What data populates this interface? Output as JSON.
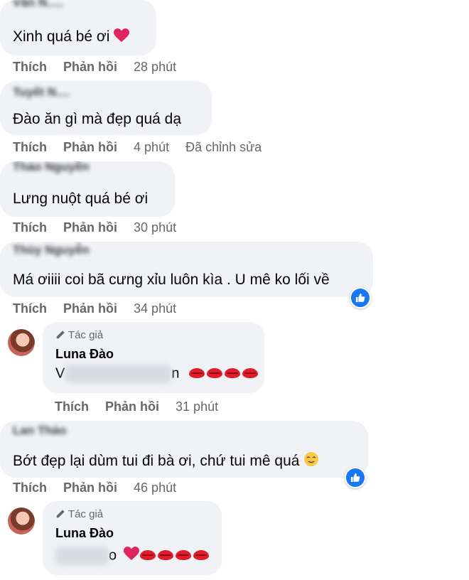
{
  "comments": [
    {
      "text": "Xinh quá bé ơi",
      "like": "Thích",
      "reply": "Phản hồi",
      "time": "28 phút",
      "edited": ""
    },
    {
      "text": "Đào ăn gì mà đẹp quá dạ",
      "like": "Thích",
      "reply": "Phản hồi",
      "time": "4 phút",
      "edited": "Đã chỉnh sửa"
    },
    {
      "text": "Lưng nuột quá bé ơi",
      "like": "Thích",
      "reply": "Phản hồi",
      "time": "30 phút",
      "edited": ""
    },
    {
      "text": "Má ơiiii coi bã cưng xỉu luôn kìa . U mê ko lối về",
      "like": "Thích",
      "reply": "Phản hồi",
      "time": "34 phút",
      "edited": ""
    },
    {
      "text": "Bớt đẹp lại dùm tui đi bà ơi, chứ tui mê quá",
      "like": "Thích",
      "reply": "Phản hồi",
      "time": "46 phút",
      "edited": ""
    }
  ],
  "replies": [
    {
      "author_tag": "Tác giả",
      "author": "Luna Đào",
      "text_prefix": "V",
      "text_suffix": "n",
      "like": "Thích",
      "reply": "Phản hồi",
      "time": "31 phút"
    },
    {
      "author_tag": "Tác giả",
      "author": "Luna Đào",
      "text_prefix": "",
      "text_suffix": "o",
      "like": "Thích",
      "reply": "Phản hồi",
      "time": ""
    }
  ],
  "icons": {
    "heart": "red-heart-emoji",
    "lips": "kiss-mark-emoji",
    "like_badge": "thumbs-up-icon",
    "author_tag": "pencil-icon",
    "relieved": "relieved-face-emoji"
  },
  "colors": {
    "bubble": "#f0f2f5",
    "meta": "#65676b",
    "like_blue": "#1877f2",
    "heart_red": "#e0245e"
  }
}
